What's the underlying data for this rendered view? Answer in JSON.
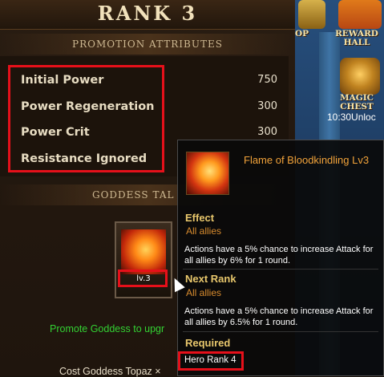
{
  "header": {
    "rank_title": "RANK 3"
  },
  "promotion": {
    "heading": "PROMOTION ATTRIBUTES",
    "attributes": [
      {
        "label": "Initial Power",
        "value": "750"
      },
      {
        "label": "Power Regeneration",
        "value": "300"
      },
      {
        "label": "Power Crit",
        "value": "300"
      },
      {
        "label": "Resistance Ignored",
        "value": ""
      }
    ]
  },
  "goddess": {
    "heading": "GODDESS TAL",
    "skill_level": "lv.3",
    "promote_text": "Promote Goddess to upgr",
    "cost_text": "Cost  Goddess Topaz ×"
  },
  "right_bar": {
    "op_label": "OP",
    "reward_hall": "REWARD\nHALL",
    "magic_chest": "MAGIC\nCHEST",
    "chest_timer": "10:30Unloc"
  },
  "tooltip": {
    "title": "Flame of Bloodkindling Lv3",
    "effect_heading": "Effect",
    "effect_target": "All allies",
    "effect_desc": "Actions have a 5% chance to increase Attack for all allies by 6% for 1 round.",
    "next_heading": "Next Rank",
    "next_target": "All allies",
    "next_desc": "Actions have a 5% chance to increase Attack for all allies by 6.5% for 1 round.",
    "required_heading": "Required",
    "required_value": "Hero Rank 4"
  },
  "colors": {
    "highlight": "#e6101a",
    "accent_title": "#f2a33a",
    "heading_gold": "#e8c76c",
    "promote_green": "#33d133"
  },
  "icons": [
    "flame-phoenix-icon",
    "reward-hall-icon",
    "magic-chest-icon",
    "cursor-icon"
  ]
}
